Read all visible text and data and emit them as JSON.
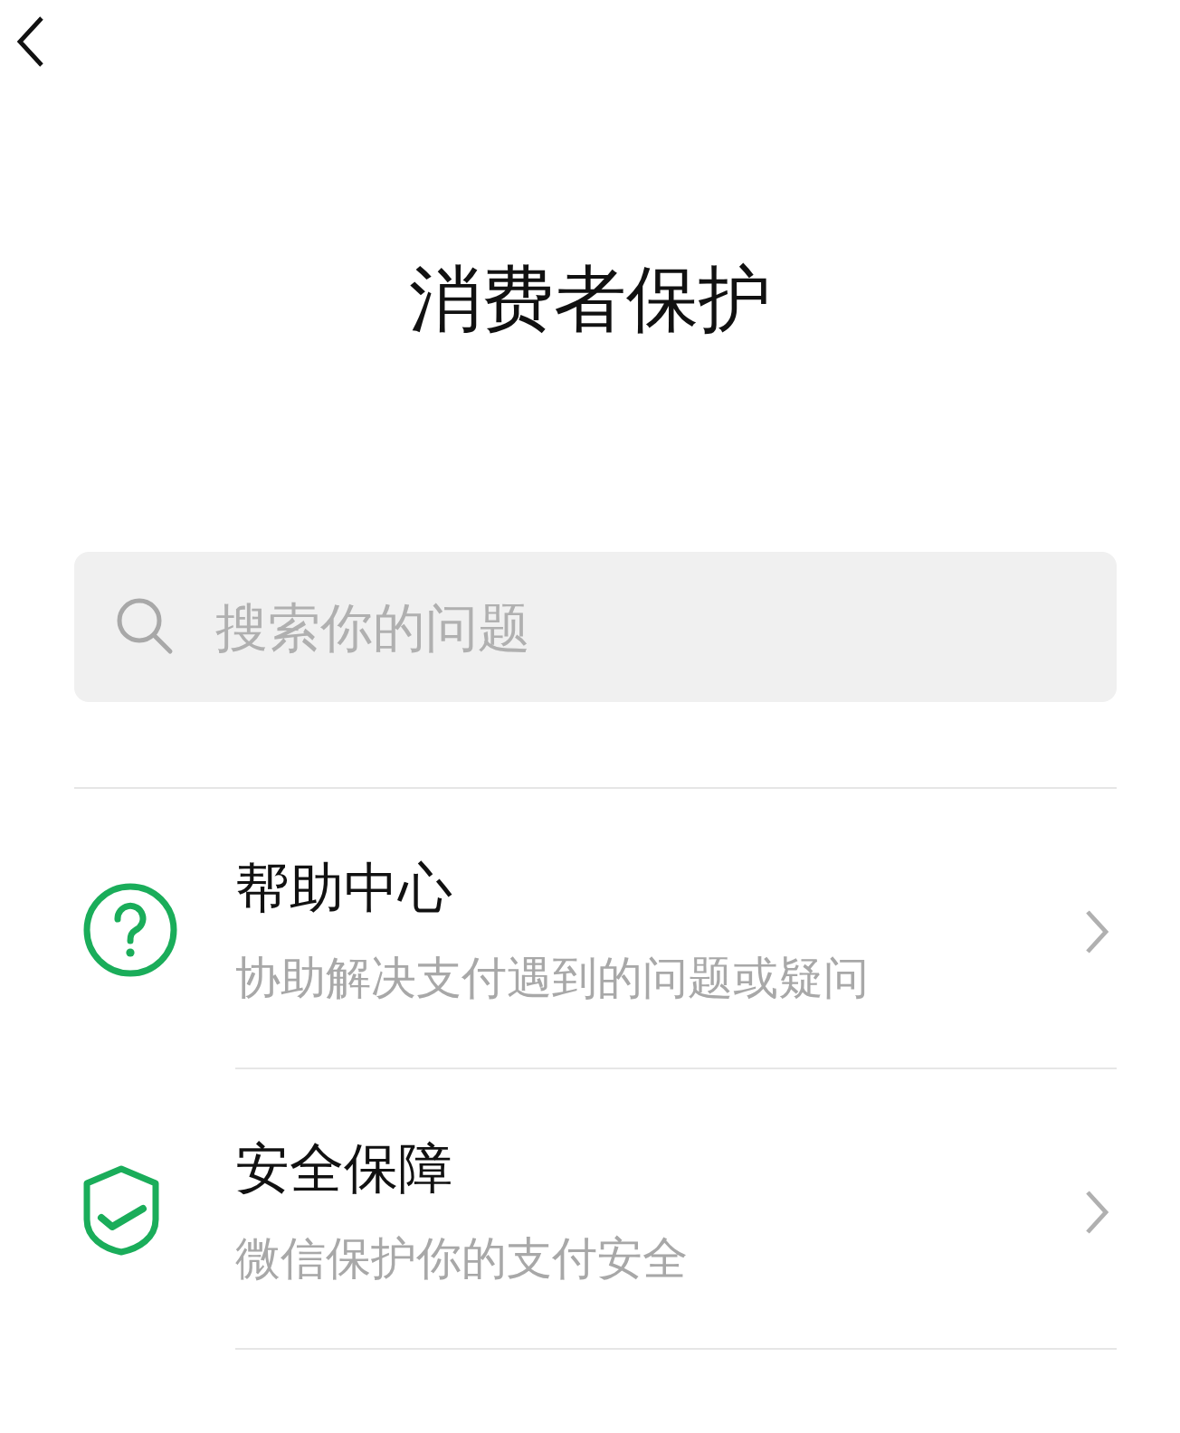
{
  "title": "消费者保护",
  "search": {
    "placeholder": "搜索你的问题"
  },
  "items": [
    {
      "kind": "help",
      "title": "帮助中心",
      "subtitle": "协助解决支付遇到的问题或疑问"
    },
    {
      "kind": "shield",
      "title": "安全保障",
      "subtitle": "微信保护你的支付安全"
    }
  ]
}
